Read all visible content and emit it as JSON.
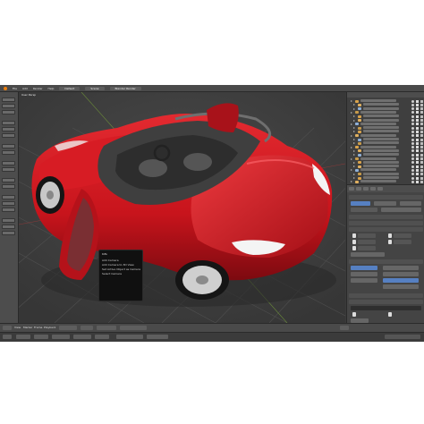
{
  "app": {
    "name": "3D modeling application",
    "scene_subject": "red roadster car model, doors open"
  },
  "menubar": {
    "items": [
      "File",
      "Add",
      "Render",
      "Help"
    ],
    "layout_field": "Default",
    "scene_field": "Scene",
    "engine_field": "Blender Render"
  },
  "viewport": {
    "header": "User Persp",
    "car_color": "#c8141c",
    "interior_color": "#4a4a4a",
    "grid_color": "#4b4b4b"
  },
  "popup": {
    "title": "Info",
    "lines": [
      "Add Camera",
      "Add Camera to 3D View",
      "Set Active Object as Camera",
      "Select Camera"
    ]
  },
  "outliner": {
    "rows": 22
  },
  "properties": {
    "tabs": [
      "Render",
      "Layers",
      "Scene",
      "World",
      "Object"
    ],
    "sections": [
      "Render",
      "Layers",
      "Shading",
      "Performance",
      "Post Processing",
      "Output"
    ]
  },
  "timeline": {
    "items": [
      "View",
      "Marker",
      "Frame",
      "Playback"
    ]
  },
  "colors": {
    "accent": "#5680c2",
    "ui_dark": "#3a3a3a",
    "ui_mid": "#4a4a4a"
  }
}
